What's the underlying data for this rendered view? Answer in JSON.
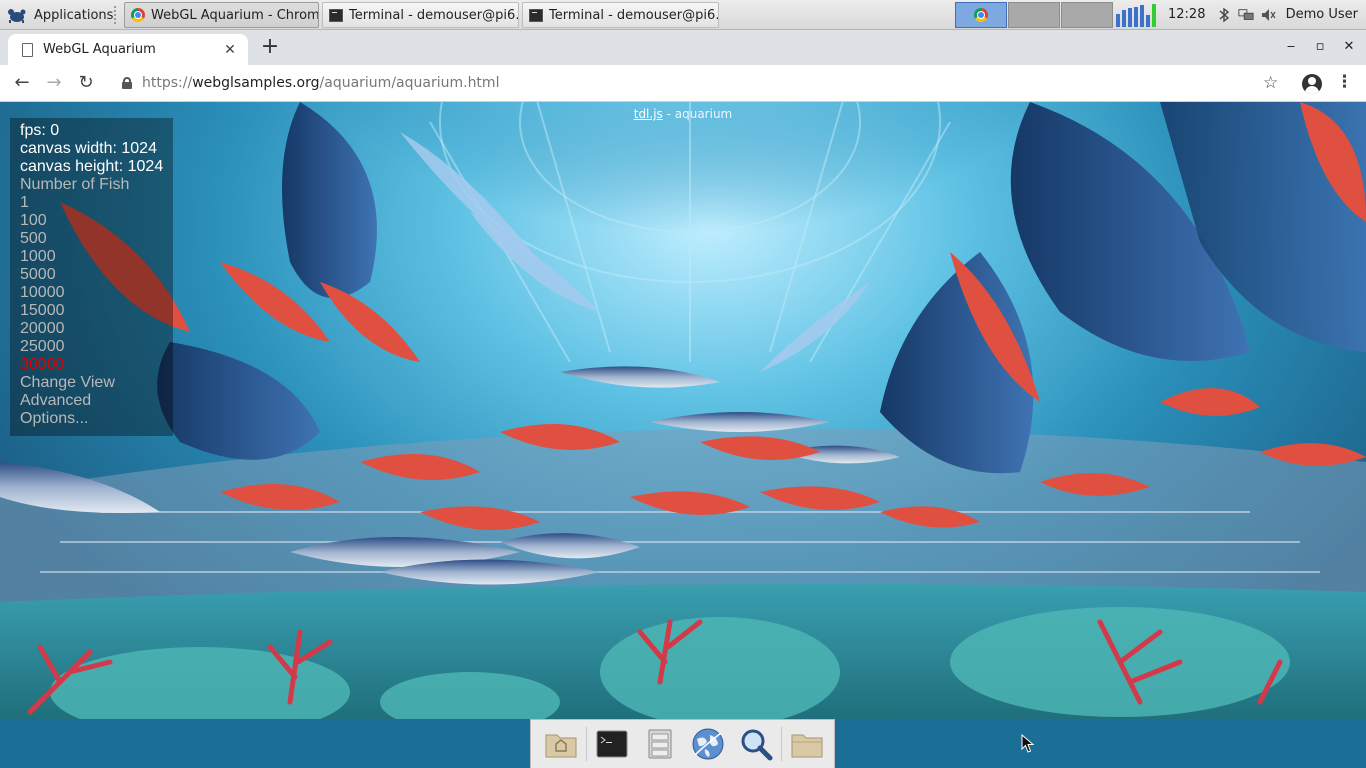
{
  "panel": {
    "apps_menu_label": "Applications",
    "tasks": [
      {
        "label": "WebGL Aquarium - Chrom…",
        "icon": "chrome-icon"
      },
      {
        "label": "Terminal - demouser@pi6…",
        "icon": "terminal-icon"
      },
      {
        "label": "Terminal - demouser@pi6…",
        "icon": "terminal-icon"
      }
    ],
    "clock": "12:28",
    "user": "Demo User",
    "cpu_levels": [
      0.55,
      0.7,
      0.8,
      0.85,
      0.9,
      0.5,
      0.95
    ],
    "tray_icons": [
      "bluetooth-icon",
      "network-icon",
      "volume-icon"
    ]
  },
  "browser": {
    "tab_title": "WebGL Aquarium",
    "tab_close": "✕",
    "new_tab": "+",
    "url_scheme": "https://",
    "url_host": "webglsamples.org",
    "url_path": "/aquarium/aquarium.html",
    "window_controls": {
      "minimize": "‒",
      "maximize": "▫",
      "close": "✕"
    },
    "nav": {
      "back": "←",
      "forward": "→",
      "reload": "↻",
      "star": "☆",
      "menu": "⋮"
    }
  },
  "aquarium": {
    "title_link": "tdl.js",
    "title_rest": " - aquarium",
    "fps": "fps: 0",
    "canvas_width": "canvas width: 1024",
    "canvas_height": "canvas height: 1024",
    "fish_heading": "Number of Fish",
    "fish_options": [
      "1",
      "100",
      "500",
      "1000",
      "5000",
      "10000",
      "15000",
      "20000",
      "25000",
      "30000"
    ],
    "selected_fish": "30000",
    "change_view": "Change View",
    "advanced": "Advanced",
    "options": "Options..."
  },
  "colors": {
    "selected_option": "#e00000",
    "panel_bg": "#dcdcdc",
    "desktop": "#1b6e95"
  },
  "dock": {
    "items": [
      "home-folder-icon",
      "terminal-icon",
      "file-manager-icon",
      "web-browser-icon",
      "search-icon",
      "folder-icon"
    ]
  }
}
